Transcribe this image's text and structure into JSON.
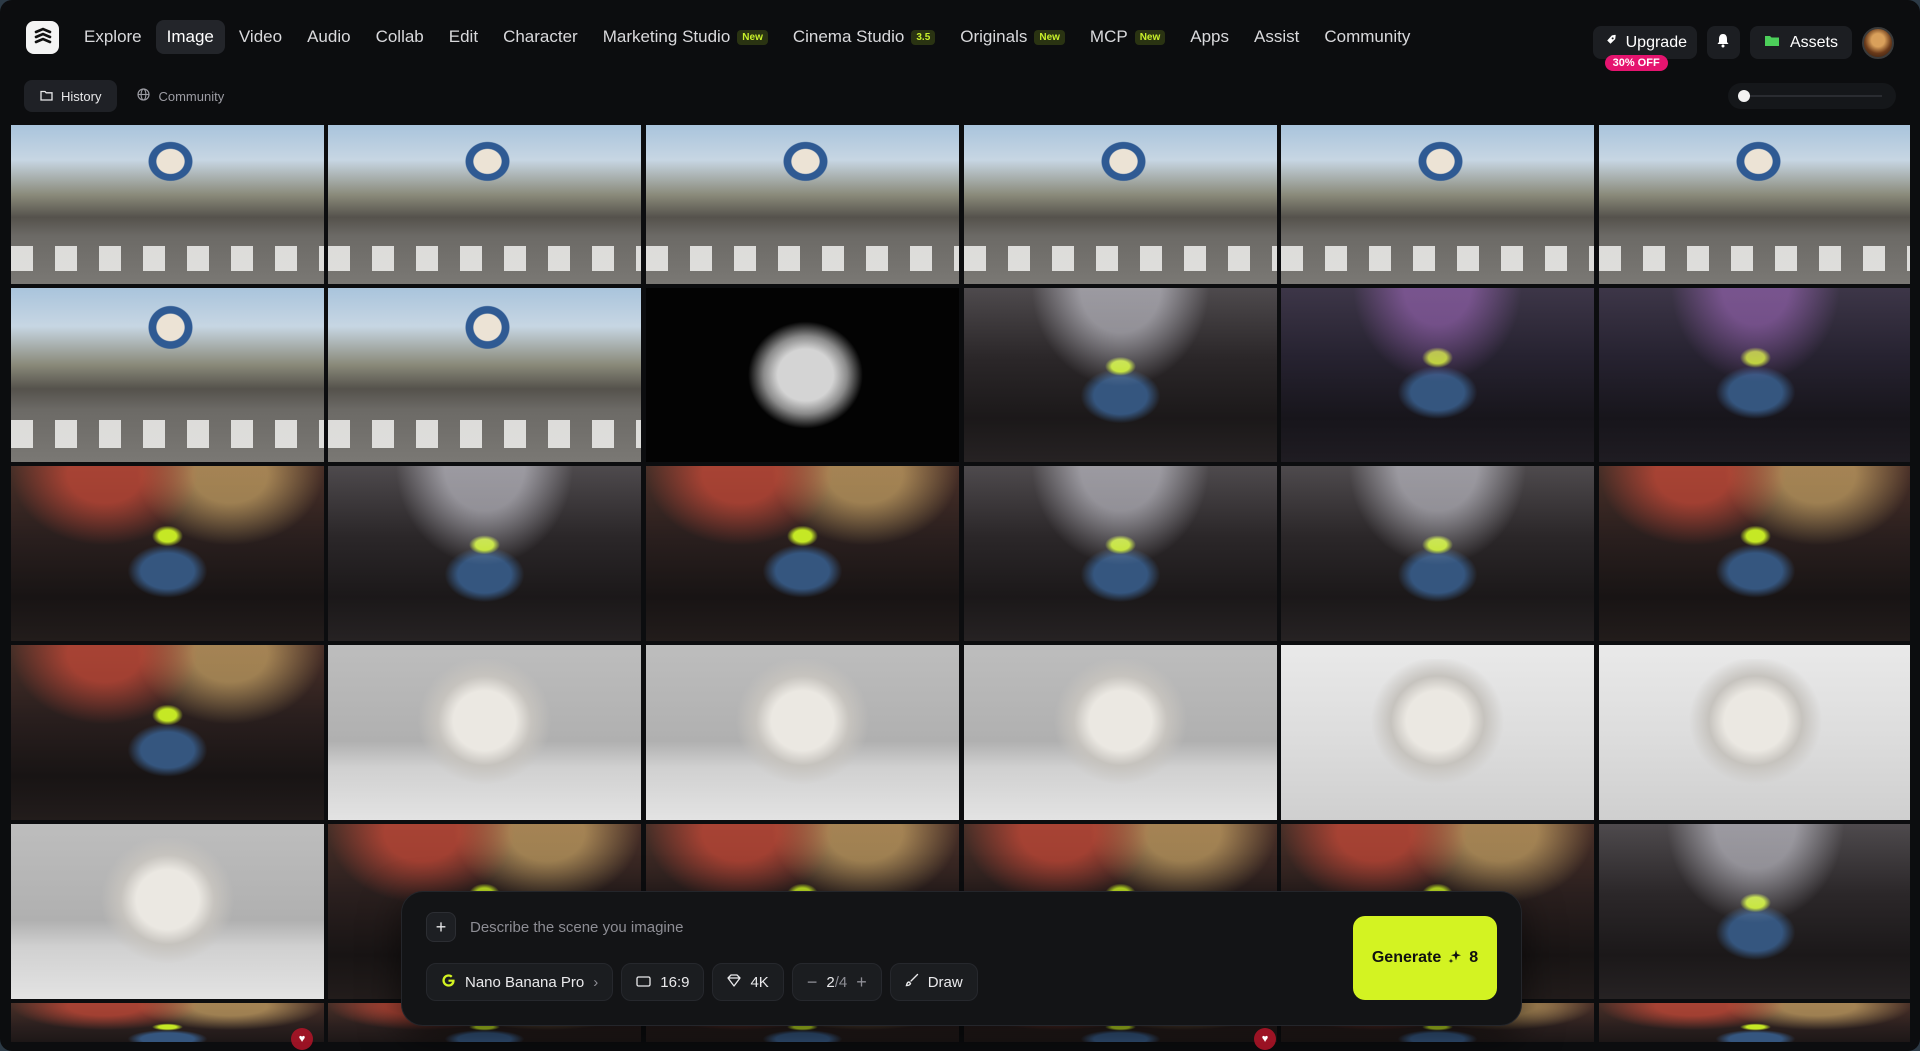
{
  "nav": {
    "items": [
      {
        "label": "Explore"
      },
      {
        "label": "Image",
        "active": true
      },
      {
        "label": "Video"
      },
      {
        "label": "Audio"
      },
      {
        "label": "Collab"
      },
      {
        "label": "Edit"
      },
      {
        "label": "Character"
      },
      {
        "label": "Marketing Studio",
        "badge": "New"
      },
      {
        "label": "Cinema Studio",
        "badge": "3.5"
      },
      {
        "label": "Originals",
        "badge": "New"
      },
      {
        "label": "MCP",
        "badge": "New"
      },
      {
        "label": "Apps"
      },
      {
        "label": "Assist"
      },
      {
        "label": "Community"
      }
    ],
    "upgrade_label": "Upgrade",
    "upgrade_discount": "30% OFF",
    "assets_label": "Assets"
  },
  "subnav": {
    "history_label": "History",
    "community_label": "Community",
    "zoom_level": 0
  },
  "gallery": {
    "rows": [
      [
        "street",
        "street",
        "street",
        "street",
        "street",
        "street"
      ],
      [
        "street",
        "street",
        "black",
        "crowd",
        "crowd purple",
        "crowd purple"
      ],
      [
        "crowd warm",
        "crowd",
        "crowd warm",
        "crowd",
        "crowd",
        "crowd warm"
      ],
      [
        "crowd warm",
        "clay",
        "clay",
        "clay",
        "clay light",
        "clay light"
      ],
      [
        "clay",
        "crowd warm",
        "crowd warm",
        "crowd warm",
        "crowd warm",
        "crowd"
      ],
      [
        "crowd warm",
        "crowd warm",
        "crowd warm",
        "crowd warm",
        "crowd warm",
        "crowd warm"
      ]
    ]
  },
  "prompt": {
    "placeholder": "Describe the scene you imagine",
    "model": "Nano Banana Pro",
    "aspect_ratio": "16:9",
    "quality": "4K",
    "count_current": "2",
    "count_total": "/4",
    "draw_label": "Draw",
    "generate_label": "Generate",
    "generate_cost": "8"
  },
  "colors": {
    "accent": "#d3f322",
    "badge_pink": "#e5146f",
    "background": "#0c0d0f"
  }
}
